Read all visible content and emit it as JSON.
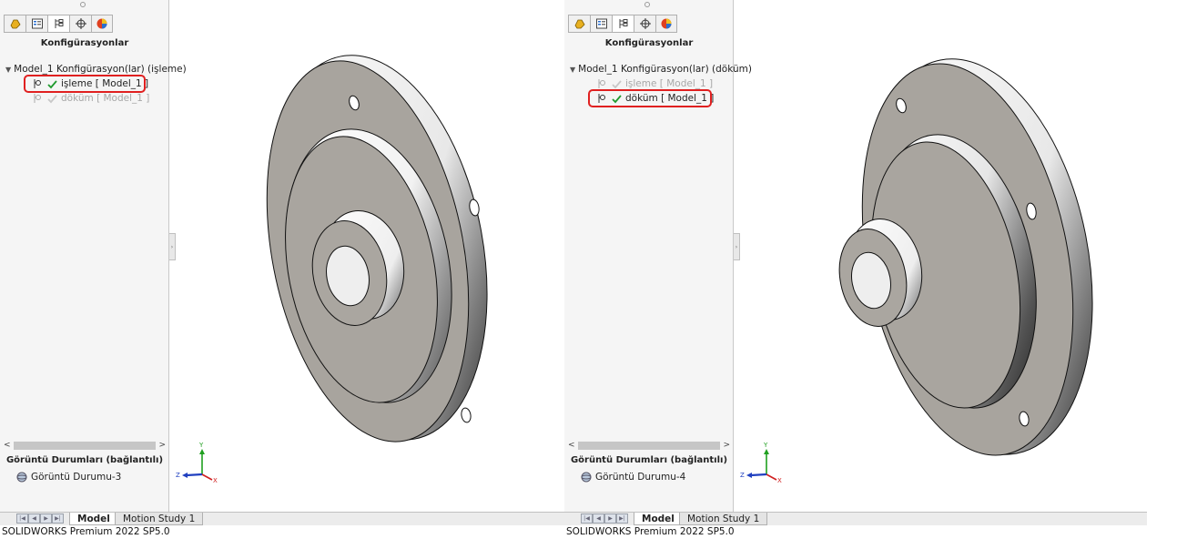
{
  "panes": [
    {
      "panel_title": "Konfigürasyonlar",
      "root_label": "Model_1 Konfigürasyon(lar)  (işleme)",
      "configs": [
        {
          "label": "işleme [ Model_1 ]",
          "active": true
        },
        {
          "label": "döküm [ Model_1 ]",
          "active": false
        }
      ],
      "display_states_title": "Görüntü Durumları (bağlantılı)",
      "display_state": "Görüntü Durumu-3",
      "tabs": {
        "model": "Model",
        "motion": "Motion Study 1"
      },
      "status": "SOLIDWORKS Premium 2022 SP5.0"
    },
    {
      "panel_title": "Konfigürasyonlar",
      "root_label": "Model_1 Konfigürasyon(lar)  (döküm)",
      "configs": [
        {
          "label": "işleme [ Model_1 ]",
          "active": false
        },
        {
          "label": "döküm [ Model_1 ]",
          "active": true
        }
      ],
      "display_states_title": "Görüntü Durumları (bağlantılı)",
      "display_state": "Görüntü Durumu-4",
      "tabs": {
        "model": "Model",
        "motion": "Motion Study 1"
      },
      "status": "SOLIDWORKS Premium 2022 SP5.0"
    }
  ],
  "triad": {
    "x": "X",
    "y": "Y",
    "z": "Z"
  },
  "colors": {
    "highlight": "#e02020",
    "check": "#1f9a2e",
    "axis_x": "#d02020",
    "axis_y": "#20a020",
    "axis_z": "#2040c0"
  }
}
